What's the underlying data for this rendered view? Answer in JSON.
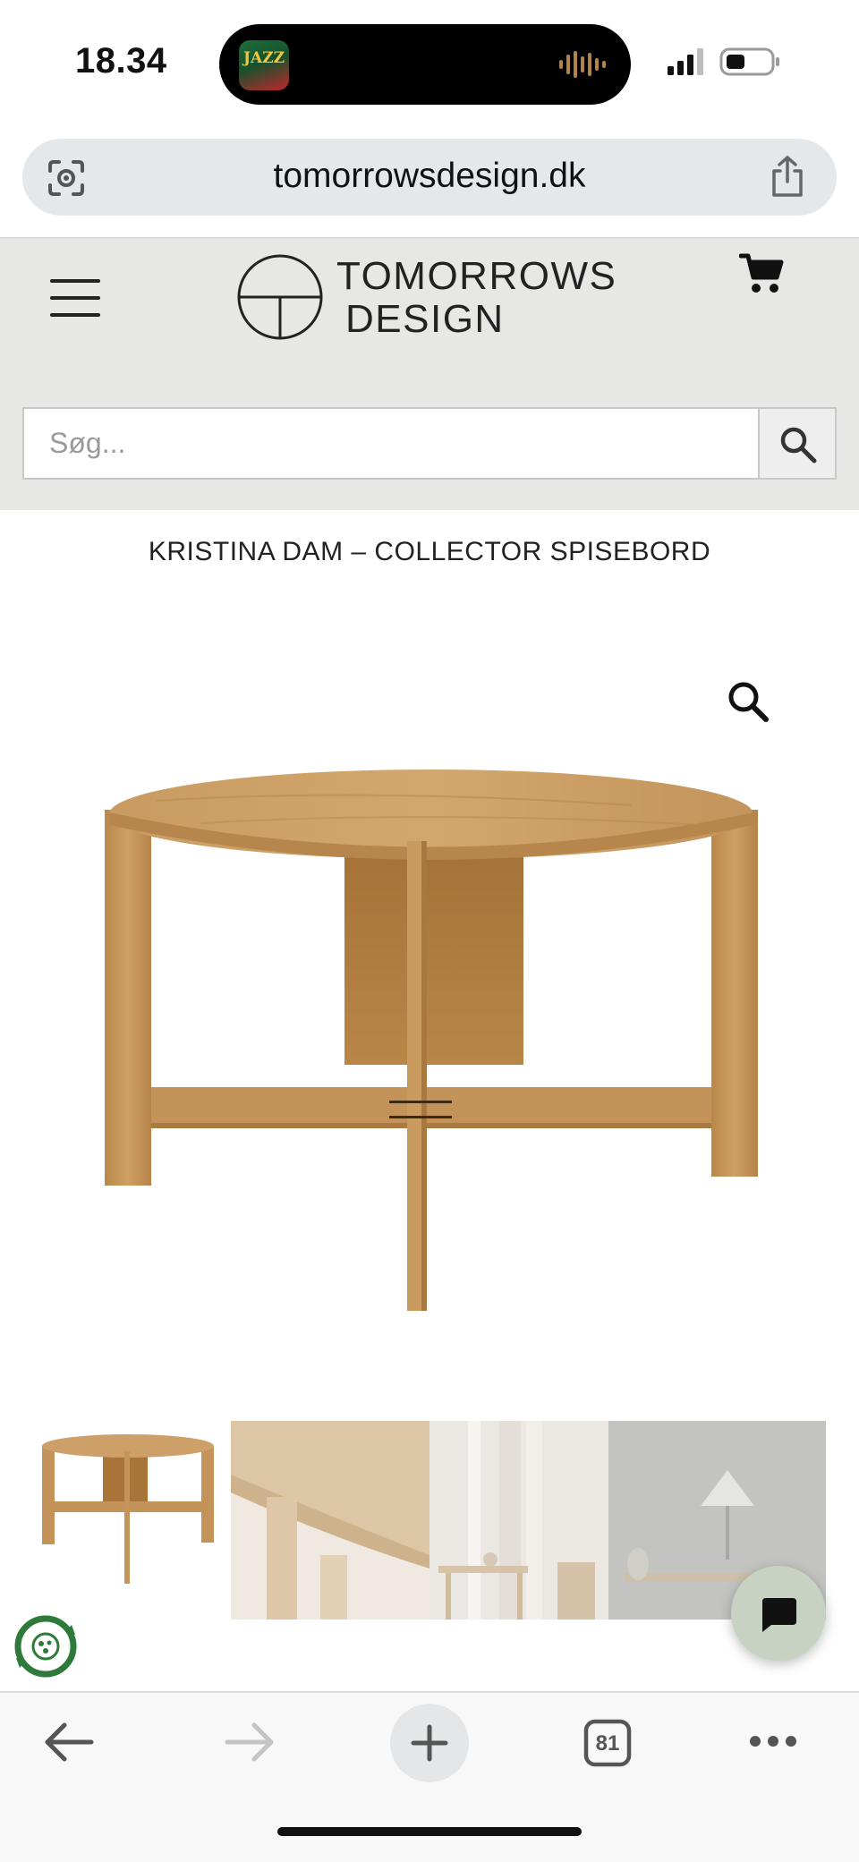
{
  "status_bar": {
    "time": "18.34",
    "now_playing_art_text": "JAZZ",
    "signal_icon": "cellular-signal-icon",
    "battery_icon": "battery-low-icon"
  },
  "browser": {
    "url": "tomorrowsdesign.dk",
    "left_icon": "visual-lookup-icon",
    "share_icon": "share-icon",
    "tabs_count": "81",
    "back_icon": "arrow-left-icon",
    "forward_icon": "arrow-right-icon",
    "new_tab_icon": "plus-icon",
    "more_icon": "more-dots-icon"
  },
  "site": {
    "logo_line1": "TOMORROWS",
    "logo_line2": "DESIGN",
    "menu_icon": "hamburger-menu-icon",
    "cart_icon": "shopping-cart-icon",
    "search_placeholder": "Søg...",
    "search_icon": "search-icon"
  },
  "product": {
    "title": "KRISTINA DAM – COLLECTOR SPISEBORD",
    "zoom_icon": "magnifier-icon",
    "image_subject": "round oak dining table",
    "thumbnail_count": 2
  },
  "widgets": {
    "chat_icon": "chat-bubble-icon",
    "eco_badge_icon": "eco-recycle-badge-icon"
  },
  "colors": {
    "header_bg": "#e7e8e6",
    "url_bar_bg": "#e5e8ea",
    "chat_button_bg": "#c7d2c2",
    "oak": "#c99b62"
  }
}
